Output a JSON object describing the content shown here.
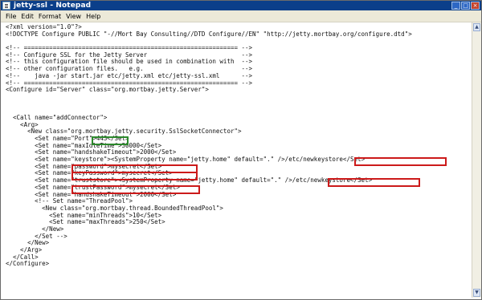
{
  "window": {
    "title": "jetty-ssl - Notepad",
    "minimize_glyph": "_",
    "maximize_glyph": "□",
    "close_glyph": "×"
  },
  "menu": [
    {
      "label": "File"
    },
    {
      "label": "Edit"
    },
    {
      "label": "Format"
    },
    {
      "label": "View"
    },
    {
      "label": "Help"
    }
  ],
  "scrollbar": {
    "up_glyph": "▲",
    "down_glyph": "▼"
  },
  "code_lines": [
    "<?xml version=\"1.0\"?>",
    "<!DOCTYPE Configure PUBLIC \"-//Mort Bay Consulting//DTD Configure//EN\" \"http://jetty.mortbay.org/configure.dtd\">",
    "",
    "<!-- =========================================================== -->",
    "<!-- Configure SSL for the Jetty Server                          -->",
    "<!-- this configuration file should be used in combination with  -->",
    "<!-- other configuration files.   e.g.                           -->",
    "<!--    java -jar start.jar etc/jetty.xml etc/jetty-ssl.xml      -->",
    "<!-- =========================================================== -->",
    "<Configure id=\"Server\" class=\"org.mortbay.jetty.Server\">",
    "",
    "",
    "",
    "  <Call name=\"addConnector\">",
    "    <Arg>",
    "      <New class=\"org.mortbay.jetty.security.SslSocketConnector\">",
    "        <Set name=\"Port\">443</Set>",
    "        <Set name=\"maxIdleTime\">30000</Set>",
    "        <Set name=\"handshakeTimeout\">2000</Set>",
    "        <Set name=\"keystore\"><SystemProperty name=\"jetty.home\" default=\".\" />/etc/newkeystore</Set>",
    "        <Set name=\"password\">mysecret</Set>",
    "        <Set name=\"keyPassword\">mysecret</Set>",
    "        <Set name=\"truststore\"><SystemProperty name=\"jetty.home\" default=\".\" />/etc/newkeystore</Set>",
    "        <Set name=\"trustPassword\">mysecret</Set>",
    "        <Set name=\"handshakeTimeout\">2000</Set>",
    "        <!-- Set name=\"ThreadPool\">",
    "          <New class=\"org.mortbay.thread.BoundedThreadPool\">",
    "            <Set name=\"minThreads\">10</Set>",
    "            <Set name=\"maxThreads\">250</Set>",
    "          </New>",
    "        </Set -->",
    "      </New>",
    "    </Arg>",
    "  </Call>",
    "</Configure>"
  ]
}
